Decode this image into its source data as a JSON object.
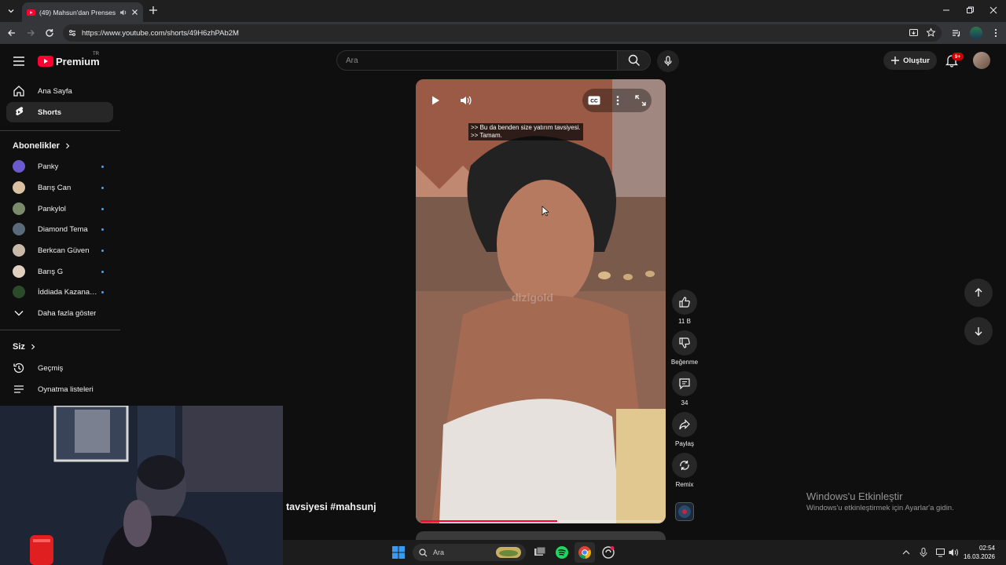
{
  "browser": {
    "tab_title": "(49) Mahsun'dan Prenses'e",
    "url": "https://www.youtube.com/shorts/49H6zhPAb2M"
  },
  "masthead": {
    "logo_text": "Premium",
    "logo_region": "TR",
    "search_placeholder": "Ara",
    "create_label": "Oluştur",
    "notification_count": "9+"
  },
  "sidebar": {
    "main": [
      {
        "label": "Ana Sayfa",
        "icon": "home-icon"
      },
      {
        "label": "Shorts",
        "icon": "shorts-icon"
      }
    ],
    "subscriptions_header": "Abonelikler",
    "subscriptions": [
      {
        "label": "Panky",
        "color": "#6a5acd"
      },
      {
        "label": "Barış Can",
        "color": "#d8c0a0"
      },
      {
        "label": "Pankylol",
        "color": "#7a8a6a"
      },
      {
        "label": "Diamond Tema",
        "color": "#5a6a7a"
      },
      {
        "label": "Berkcan Güven",
        "color": "#c8b8a8"
      },
      {
        "label": "Barış G",
        "color": "#e0d0c0"
      },
      {
        "label": "İddiada Kazanan...",
        "color": "#2a4a2a"
      }
    ],
    "show_more": "Daha fazla göster",
    "you_header": "Siz",
    "you_items": [
      {
        "label": "Geçmiş",
        "icon": "history-icon"
      },
      {
        "label": "Oynatma listeleri",
        "icon": "playlist-icon"
      }
    ]
  },
  "player": {
    "captions": [
      ">> Bu da benden size yatırım tavsiyesi.",
      ">> Tamam."
    ],
    "watermark": "dizigold",
    "progress": 0.57
  },
  "actions": {
    "like_count": "11 B",
    "dislike_label": "Beğenme",
    "comment_count": "34",
    "share_label": "Paylaş",
    "remix_label": "Remix"
  },
  "video_title": "tavsiyesi #mahsunj",
  "windows_activation": {
    "title": "Windows'u Etkinleştir",
    "subtitle": "Windows'u etkinleştirmek için Ayarlar'a gidin."
  },
  "taskbar": {
    "search_label": "Ara",
    "time": "02:54",
    "date": "16.03.2026"
  },
  "colors": {
    "accent_red": "#ff0033",
    "background": "#0f0f0f"
  }
}
